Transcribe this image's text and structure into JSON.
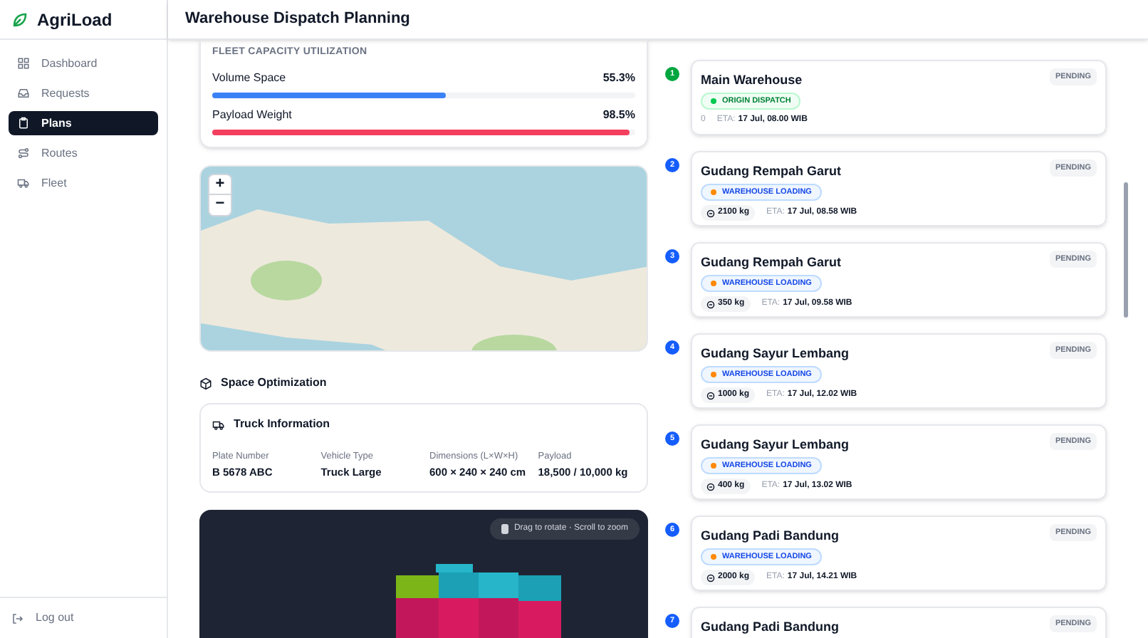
{
  "brand": "AgriLoad",
  "nav": [
    {
      "label": "Dashboard",
      "selected": false
    },
    {
      "label": "Requests",
      "selected": false
    },
    {
      "label": "Plans",
      "selected": true
    },
    {
      "label": "Routes",
      "selected": false
    },
    {
      "label": "Fleet",
      "selected": false
    }
  ],
  "logout": "Log out",
  "header": {
    "title": "Warehouse Dispatch Planning"
  },
  "capacity": {
    "title": "FLEET CAPACITY UTILIZATION",
    "meters": [
      {
        "label": "Volume Space",
        "reading": "55.3%",
        "level": 0.553,
        "color": "#3b82f6"
      },
      {
        "label": "Payload Weight",
        "reading": "98.5%",
        "level": 0.985,
        "color": "#f43f5e"
      }
    ]
  },
  "map": {
    "zoom_in": "+",
    "zoom_out": "−"
  },
  "space": {
    "title": "Space Optimization",
    "truck": {
      "title": "Truck Information",
      "fields": [
        {
          "label": "Plate Number",
          "value": "B 5678 ABC"
        },
        {
          "label": "Vehicle Type",
          "value": "Truck Large"
        },
        {
          "label": "Dimensions (L×W×H)",
          "value": "600 × 240 × 240 cm"
        },
        {
          "label": "Payload",
          "value": "18,500 / 10,000 kg"
        }
      ]
    },
    "viewer_hint": "Drag to rotate · Scroll to zoom"
  },
  "stops": [
    {
      "number": "1",
      "kind": "origin",
      "name": "Main Warehouse",
      "status": "PENDING",
      "tag": "ORIGIN DISPATCH",
      "weight": "0",
      "eta_label": "ETA:",
      "eta": "17 Jul, 08.00 WIB"
    },
    {
      "number": "2",
      "kind": "loading",
      "name": "Gudang Rempah Garut",
      "status": "PENDING",
      "tag": "WAREHOUSE LOADING",
      "weight": "2100 kg",
      "eta_label": "ETA:",
      "eta": "17 Jul, 08.58 WIB"
    },
    {
      "number": "3",
      "kind": "loading",
      "name": "Gudang Rempah Garut",
      "status": "PENDING",
      "tag": "WAREHOUSE LOADING",
      "weight": "350 kg",
      "eta_label": "ETA:",
      "eta": "17 Jul, 09.58 WIB"
    },
    {
      "number": "4",
      "kind": "loading",
      "name": "Gudang Sayur Lembang",
      "status": "PENDING",
      "tag": "WAREHOUSE LOADING",
      "weight": "1000 kg",
      "eta_label": "ETA:",
      "eta": "17 Jul, 12.02 WIB"
    },
    {
      "number": "5",
      "kind": "loading",
      "name": "Gudang Sayur Lembang",
      "status": "PENDING",
      "tag": "WAREHOUSE LOADING",
      "weight": "400 kg",
      "eta_label": "ETA:",
      "eta": "17 Jul, 13.02 WIB"
    },
    {
      "number": "6",
      "kind": "loading",
      "name": "Gudang Padi Bandung",
      "status": "PENDING",
      "tag": "WAREHOUSE LOADING",
      "weight": "2000 kg",
      "eta_label": "ETA:",
      "eta": "17 Jul, 14.21 WIB"
    },
    {
      "number": "7",
      "kind": "loading",
      "name": "Gudang Padi Bandung",
      "status": "PENDING"
    }
  ]
}
